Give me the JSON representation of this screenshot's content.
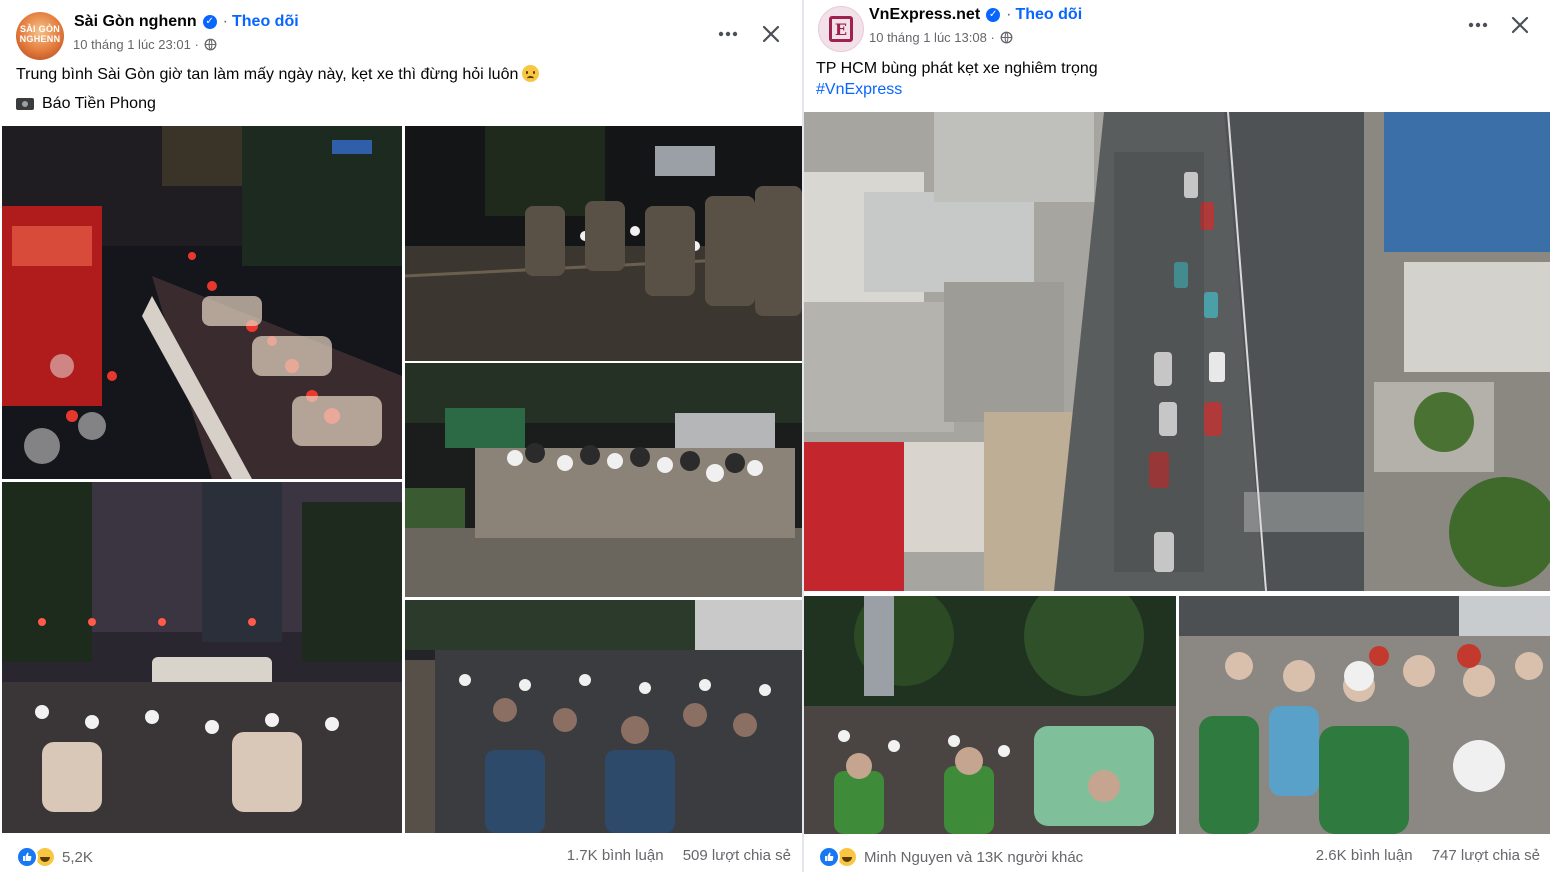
{
  "left_post": {
    "page_name": "Sài Gòn nghenn",
    "avatar_text": "SÀI GÒN NGHENN",
    "follow_label": "Theo dõi",
    "timestamp": "10 tháng 1 lúc 23:01",
    "caption": "Trung bình Sài Gòn giờ tan làm mấy ngày này, kẹt xe thì đừng hỏi luôn",
    "credit": "Báo Tiền Phong",
    "reaction_count": "5,2K",
    "comments": "1.7K bình luận",
    "shares": "509 lượt chia sẻ",
    "photos": [
      "night traffic jam with red bus",
      "motorbikes on wet sidewalk at night",
      "motorbikes waiting with green bus",
      "traffic lights at night intersection",
      "dense motorbike crowd on street"
    ]
  },
  "right_post": {
    "page_name": "VnExpress.net",
    "avatar_letter": "E",
    "follow_label": "Theo dõi",
    "timestamp": "10 tháng 1 lúc 13:08",
    "caption": "TP HCM bùng phát kẹt xe nghiêm trọng",
    "hashtag": "#VnExpress",
    "reaction_text": "Minh Nguyen và 13K người khác",
    "comments": "2.6K bình luận",
    "shares": "747 lượt chia sẻ",
    "photos": [
      "aerial view of congested road",
      "evening motorbike traffic with taxi",
      "riders in green jackets at daytime"
    ]
  },
  "icons": {
    "verified": "verified-icon",
    "privacy": "globe-icon",
    "more": "more-icon",
    "close": "close-icon",
    "like": "like-icon",
    "haha": "haha-icon",
    "camera": "camera-icon"
  },
  "colors": {
    "accent": "#0866ff",
    "secondary_text": "#65676b",
    "vnexpress_brand": "#9f224e"
  }
}
